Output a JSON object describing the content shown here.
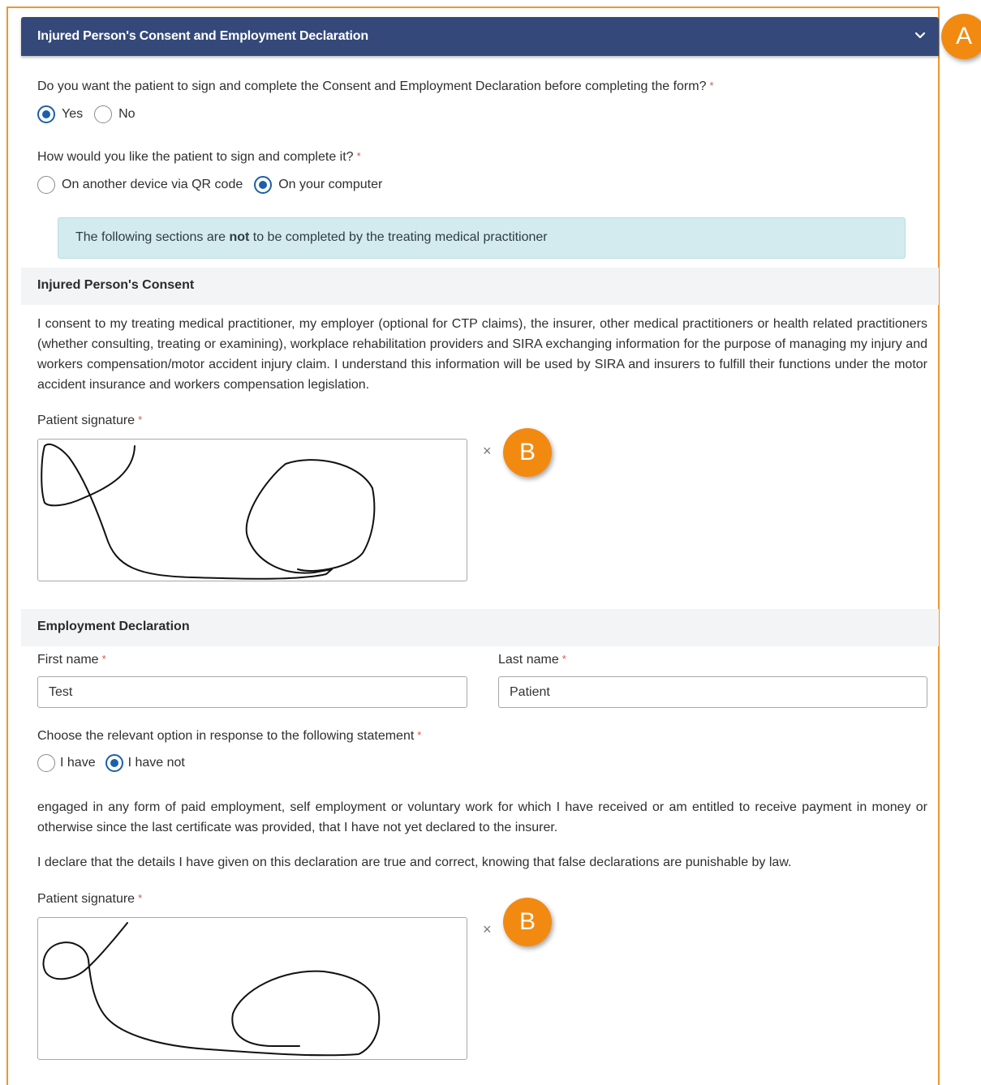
{
  "header": {
    "title": "Injured Person's Consent and Employment Declaration"
  },
  "callouts": {
    "a": "A",
    "b1": "B",
    "b2": "B"
  },
  "q1": {
    "label": "Do you want the patient to sign and complete the Consent and Employment Declaration before completing the form?",
    "required": "*",
    "options": [
      "Yes",
      "No"
    ],
    "selected": "Yes"
  },
  "q2": {
    "label": "How would you like the patient to sign and complete it?",
    "required": "*",
    "options": [
      "On another device via QR code",
      "On your computer"
    ],
    "selected": "On your computer"
  },
  "info": {
    "before": "The following sections are ",
    "bold": "not",
    "after": " to be completed by the treating medical practitioner"
  },
  "consent": {
    "title": "Injured Person's Consent",
    "text": "I consent to my treating medical practitioner, my employer (optional for CTP claims), the insurer, other medical practitioners or health related practitioners (whether consulting, treating or examining), workplace rehabilitation providers and SIRA exchanging information for the purpose of managing my injury and workers compensation/motor accident injury claim. I understand this information will be used by SIRA and insurers to fulfill their functions under the motor accident insurance and workers compensation legislation.",
    "signature_label": "Patient signature",
    "required": "*",
    "clear_symbol": "×"
  },
  "employment": {
    "title": "Employment Declaration",
    "first_name_label": "First name",
    "first_name_value": "Test",
    "last_name_label": "Last name",
    "last_name_value": "Patient",
    "required": "*",
    "statement_label": "Choose the relevant option in response to the following statement",
    "options": [
      "I have",
      "I have not"
    ],
    "selected": "I have not",
    "statement_text": "engaged in any form of paid employment, self employment or voluntary work for which I have received or am entitled to receive payment in money or otherwise since the last certificate was provided, that I have not yet declared to the insurer.",
    "declaration_text": "I declare that the details I have given on this declaration are true and correct, knowing that false declarations are punishable by law.",
    "signature_label": "Patient signature",
    "clear_symbol": "×"
  },
  "colors": {
    "header_bg": "#34497a",
    "frame_border": "#f0962e",
    "callout": "#f28a12",
    "radio_selected": "#1d5fa8",
    "required": "#d9534f",
    "info_bg": "#d3ebef"
  }
}
